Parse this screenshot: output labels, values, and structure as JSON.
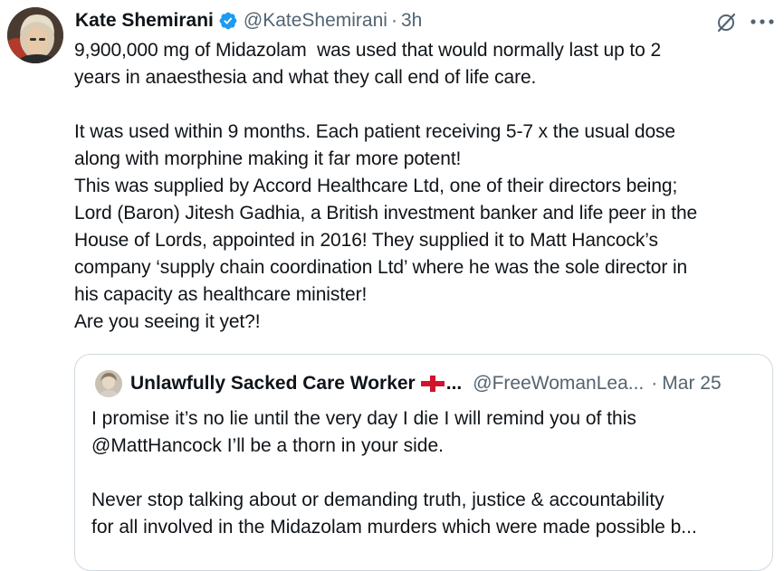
{
  "tweet": {
    "author_name": "Kate Shemirani",
    "handle": "@KateShemirani",
    "separator": "·",
    "time": "3h",
    "avatar_icon": "profile-photo",
    "verified_icon": "verified-badge-icon",
    "verified_color": "#1d9bf0",
    "body_paragraphs": [
      "9,900,000 mg of Midazolam  was used that would normally last up to 2\nyears in anaesthesia and what they call end of life care.",
      "",
      "It was used within 9 months. Each patient receiving 5-7 x the usual dose\nalong with morphine making it far more potent!\nThis was supplied by Accord Healthcare Ltd, one of their directors being;\nLord (Baron) Jitesh Gadhia, a British investment banker and life peer in the\nHouse of Lords, appointed in 2016! They supplied it to Matt Hancock’s\ncompany ‘supply chain coordination Ltd’ where he was the sole director in\nhis capacity as healthcare minister!\nAre you seeing it yet?!"
    ]
  },
  "quote": {
    "author_name": "Unlawfully Sacked Care Worker",
    "flag_icon": "england-flag-icon",
    "name_ellipsis": "...",
    "handle": "@FreeWomanLea...",
    "separator": "·",
    "time": "Mar 25",
    "body_paragraphs": [
      "I promise it’s no lie until the very day I die I will remind you of this\n@MattHancock I’ll be a thorn in your side.",
      "",
      "Never stop talking about or demanding truth, justice & accountability\nfor all involved in the Midazolam murders which were made possible b..."
    ]
  },
  "actions": {
    "grok_icon": "grok-icon",
    "more_icon": "more-options-icon"
  },
  "colors": {
    "text_primary": "#0f1419",
    "text_secondary": "#536471",
    "border": "#cfd9de",
    "verified_blue": "#1d9bf0",
    "flag_red": "#cf142b"
  }
}
